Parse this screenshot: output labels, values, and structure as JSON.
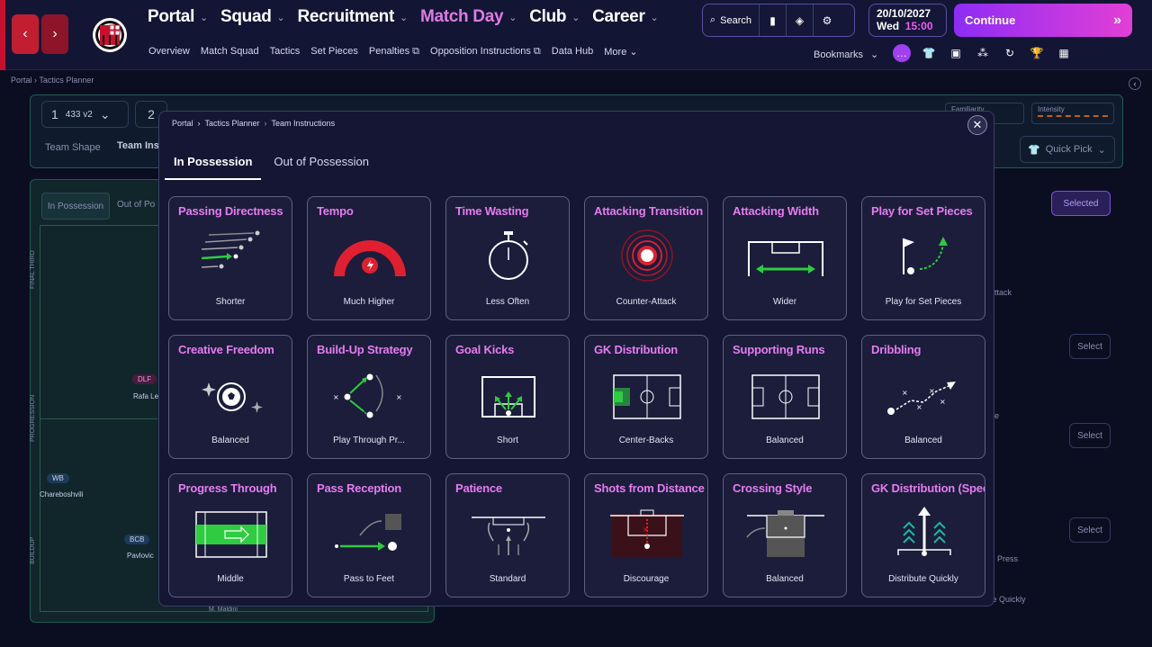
{
  "topnav": {
    "main": [
      {
        "label": "Portal",
        "active": false
      },
      {
        "label": "Squad",
        "active": false
      },
      {
        "label": "Recruitment",
        "active": false
      },
      {
        "label": "Match Day",
        "active": true
      },
      {
        "label": "Club",
        "active": false
      },
      {
        "label": "Career",
        "active": false
      }
    ],
    "sub": [
      "Overview",
      "Match Squad",
      "Tactics",
      "Set Pieces",
      "Penalties",
      "Opposition Instructions",
      "Data Hub",
      "More"
    ],
    "search_label": "Search",
    "date": "20/10/2027",
    "day": "Wed",
    "time": "15:00",
    "continue_label": "Continue",
    "bookmarks_label": "Bookmarks"
  },
  "background": {
    "breadcrumb": [
      "Portal",
      "Tactics Planner"
    ],
    "formation_number": "1",
    "formation": "433 v2",
    "formation_number2": "2",
    "tabs": [
      "Team Shape",
      "Team Ins"
    ],
    "possession_tabs": [
      "In Possession",
      "Out of Po"
    ],
    "zones": [
      "FINAL THIRD",
      "PROGRESSION",
      "BUILDUP"
    ],
    "players": [
      {
        "role": "DLF",
        "name": "Rafa Le"
      },
      {
        "role": "WB",
        "name": "Chareboshvili"
      },
      {
        "role": "BCB",
        "name": "Pavlovic"
      }
    ],
    "familiarity_label": "Familiarity",
    "intensity_label": "Intensity",
    "quick_pick_label": "Quick Pick",
    "selected_label": "Selected",
    "select_label": "Select",
    "side_texts": [
      "ttack",
      "e",
      "Press",
      "te Quickly"
    ],
    "bottom_name": "M. Maldini"
  },
  "modal": {
    "breadcrumb": [
      "Portal",
      "Tactics Planner",
      "Team Instructions"
    ],
    "tabs": [
      {
        "label": "In Possession",
        "active": true
      },
      {
        "label": "Out of Possession",
        "active": false
      }
    ],
    "cards": [
      {
        "title": "Passing Directness",
        "value": "Shorter",
        "icon": "passing-directness-icon"
      },
      {
        "title": "Tempo",
        "value": "Much Higher",
        "icon": "tempo-gauge-icon"
      },
      {
        "title": "Time Wasting",
        "value": "Less Often",
        "icon": "stopwatch-icon"
      },
      {
        "title": "Attacking Transition",
        "value": "Counter-Attack",
        "icon": "counter-attack-icon"
      },
      {
        "title": "Attacking Width",
        "value": "Wider",
        "icon": "attacking-width-icon"
      },
      {
        "title": "Play for Set Pieces",
        "value": "Play for Set Pieces",
        "icon": "corner-flag-icon"
      },
      {
        "title": "Creative Freedom",
        "value": "Balanced",
        "icon": "creative-ball-icon"
      },
      {
        "title": "Build-Up Strategy",
        "value": "Play Through Pr...",
        "icon": "build-up-icon"
      },
      {
        "title": "Goal Kicks",
        "value": "Short",
        "icon": "goal-kick-icon"
      },
      {
        "title": "GK Distribution",
        "value": "Center-Backs",
        "icon": "gk-distribution-icon"
      },
      {
        "title": "Supporting Runs",
        "value": "Balanced",
        "icon": "supporting-runs-icon"
      },
      {
        "title": "Dribbling",
        "value": "Balanced",
        "icon": "dribbling-icon"
      },
      {
        "title": "Progress Through",
        "value": "Middle",
        "icon": "progress-middle-icon"
      },
      {
        "title": "Pass Reception",
        "value": "Pass to Feet",
        "icon": "pass-reception-icon"
      },
      {
        "title": "Patience",
        "value": "Standard",
        "icon": "patience-icon"
      },
      {
        "title": "Shots from Distance",
        "value": "Discourage",
        "icon": "shots-distance-icon"
      },
      {
        "title": "Crossing Style",
        "value": "Balanced",
        "icon": "crossing-style-icon"
      },
      {
        "title": "GK Distribution (Speed",
        "value": "Distribute Quickly",
        "icon": "gk-speed-icon"
      }
    ]
  },
  "colors": {
    "accent": "#e57cf0",
    "active_nav": "#e07be3",
    "green": "#2ecc40",
    "red": "#e02030",
    "continue_start": "#8d2cf5",
    "continue_end": "#e33fd6"
  }
}
